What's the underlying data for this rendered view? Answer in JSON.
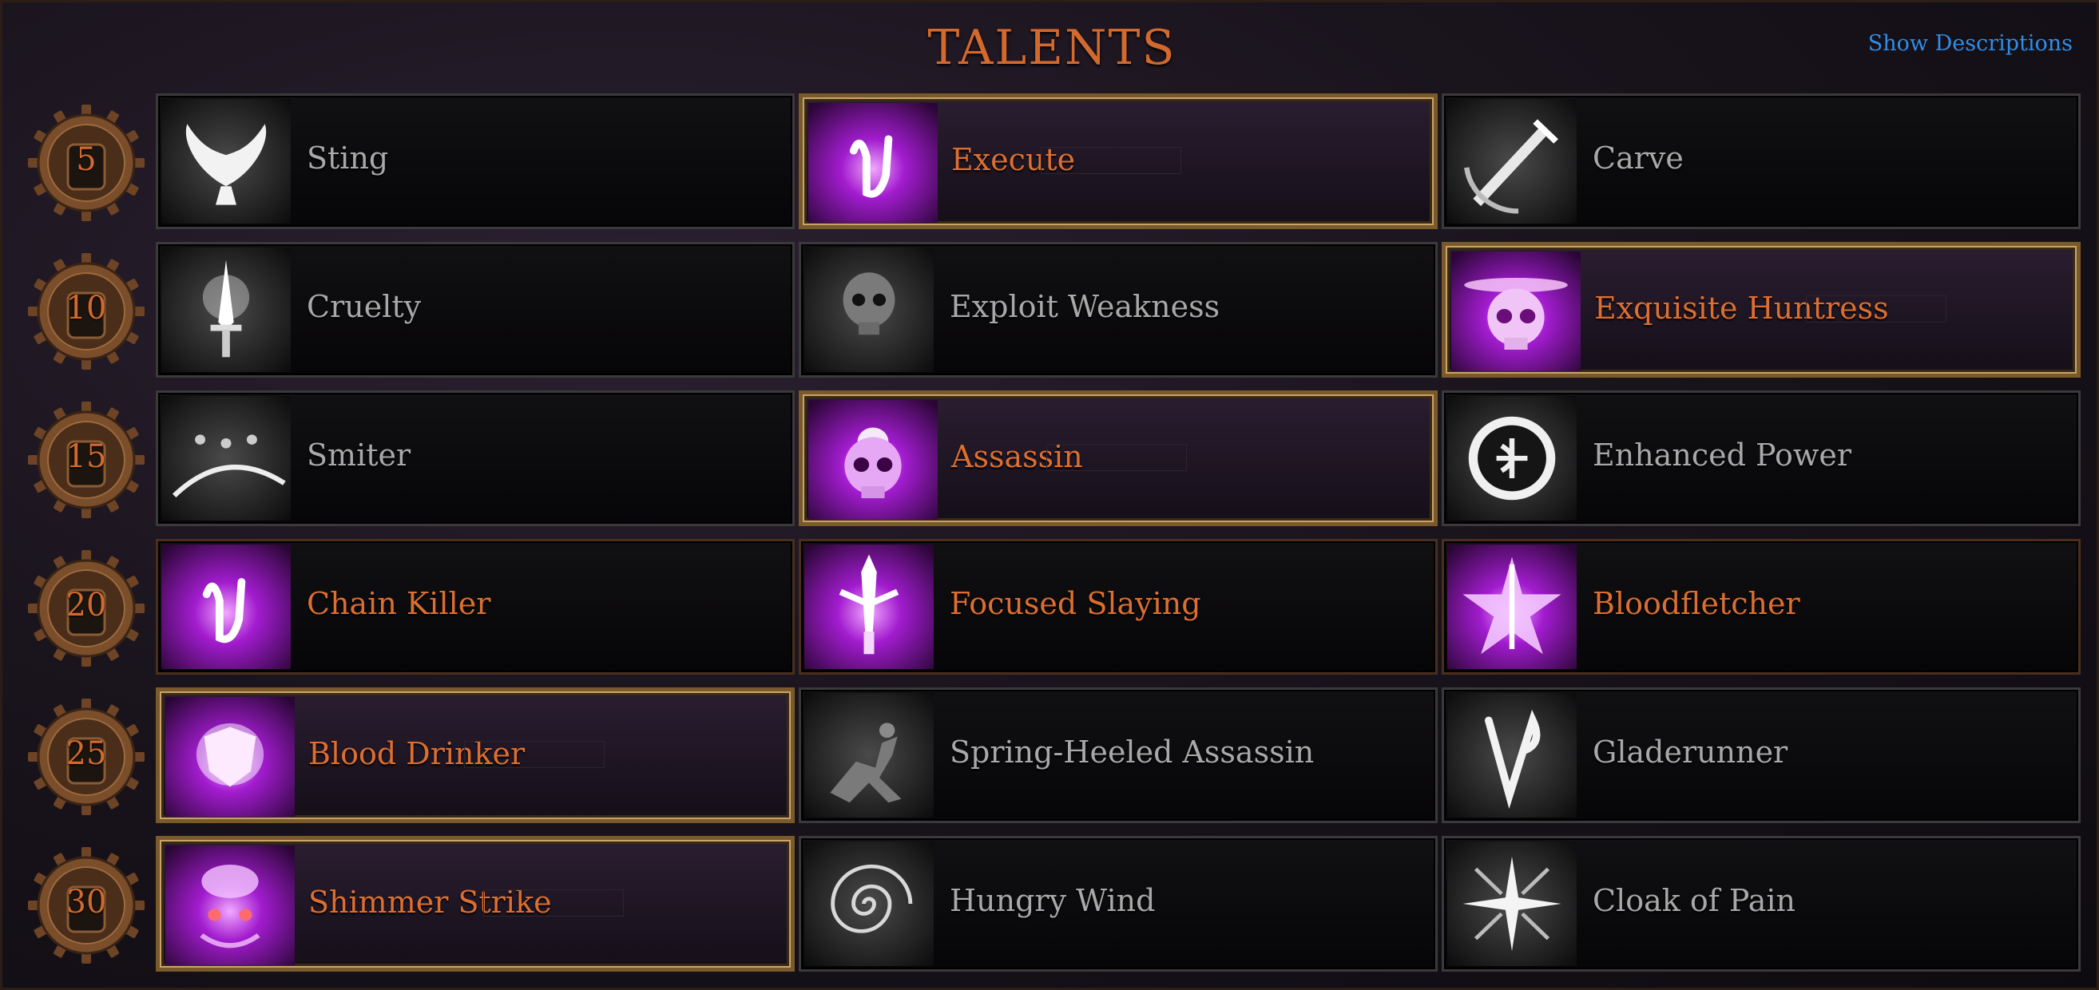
{
  "header": {
    "title": "TALENTS",
    "show_descriptions": "Show Descriptions"
  },
  "colors": {
    "accent_orange": "#dc6f30",
    "link_blue": "#2f8de8",
    "locked_text": "#a8a8a8",
    "selected_border": "#c9a46a"
  },
  "rows": [
    {
      "level": "5",
      "talents": [
        {
          "label": "Sting",
          "state": "locked",
          "icon": "dove-icon"
        },
        {
          "label": "Execute",
          "state": "selected",
          "icon": "rune-glyph-icon"
        },
        {
          "label": "Carve",
          "state": "locked",
          "icon": "dagger-slash-icon"
        }
      ]
    },
    {
      "level": "10",
      "talents": [
        {
          "label": "Cruelty",
          "state": "locked",
          "icon": "glowing-dagger-icon"
        },
        {
          "label": "Exploit Weakness",
          "state": "locked",
          "icon": "skull-icon"
        },
        {
          "label": "Exquisite Huntress",
          "state": "selected",
          "icon": "glowing-skull-icon"
        }
      ]
    },
    {
      "level": "15",
      "talents": [
        {
          "label": "Smiter",
          "state": "locked",
          "icon": "shadow-figures-icon"
        },
        {
          "label": "Assassin",
          "state": "selected",
          "icon": "purple-skull-icon"
        },
        {
          "label": "Enhanced Power",
          "state": "locked",
          "icon": "circle-rune-icon"
        }
      ]
    },
    {
      "level": "20",
      "talents": [
        {
          "label": "Chain Killer",
          "state": "unlocked",
          "icon": "rune-glyph-icon"
        },
        {
          "label": "Focused Slaying",
          "state": "unlocked",
          "icon": "sword-icon"
        },
        {
          "label": "Bloodfletcher",
          "state": "unlocked",
          "icon": "star-arrow-icon"
        }
      ]
    },
    {
      "level": "25",
      "talents": [
        {
          "label": "Blood Drinker",
          "state": "selected",
          "icon": "shield-glow-icon"
        },
        {
          "label": "Spring-Heeled Assassin",
          "state": "locked",
          "icon": "leaping-assassin-icon"
        },
        {
          "label": "Gladerunner",
          "state": "locked",
          "icon": "v-rune-icon"
        }
      ]
    },
    {
      "level": "30",
      "talents": [
        {
          "label": "Shimmer Strike",
          "state": "selected",
          "icon": "demon-face-icon"
        },
        {
          "label": "Hungry Wind",
          "state": "locked",
          "icon": "spiral-icon"
        },
        {
          "label": "Cloak of Pain",
          "state": "locked",
          "icon": "starburst-icon"
        }
      ]
    }
  ]
}
